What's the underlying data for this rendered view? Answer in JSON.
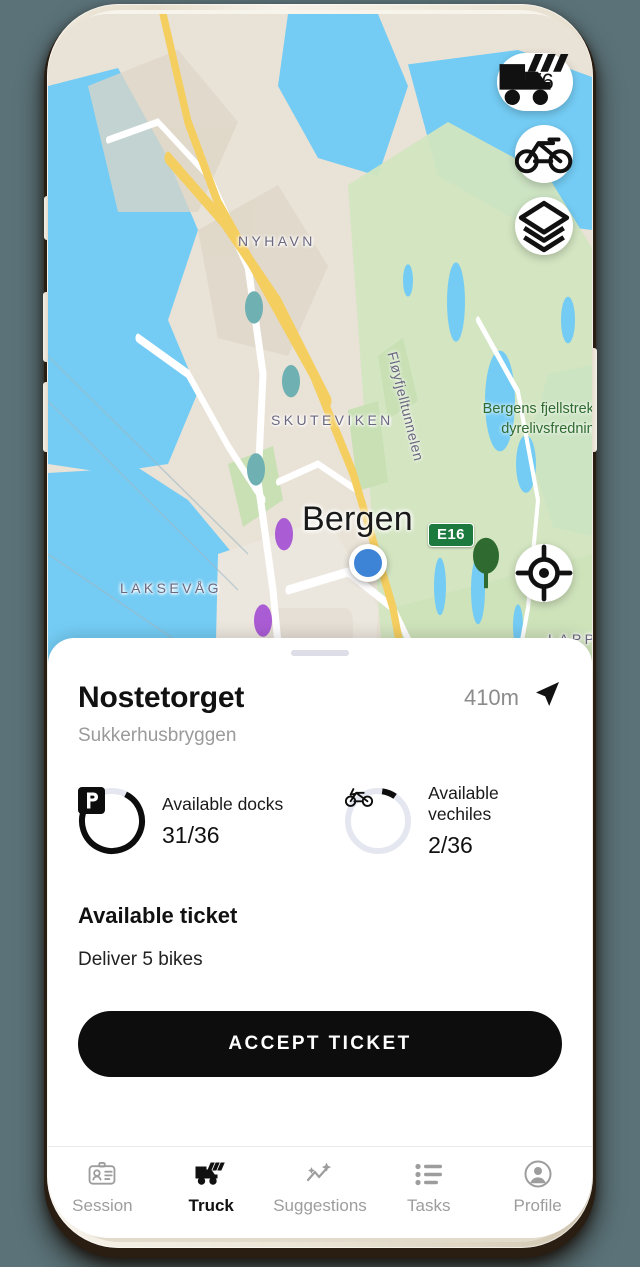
{
  "map": {
    "controls": {
      "truck_capacity": "4/6",
      "truck_icon": "truck-with-bikes-icon",
      "bike_icon": "bike-icon",
      "layers_icon": "layers-icon",
      "locate_icon": "gps-crosshair-icon"
    },
    "labels": {
      "city": "Bergen",
      "nyhavn": "NYHAVN",
      "skuteviken": "SKUTEVIKEN",
      "laksevag": "LAKSEVÅG",
      "lappen": "LAPPEN",
      "tunnel": "Fløyfjelltunnelen",
      "highway_shield": "E16",
      "nature_line1": "Bergens fjellstrekning",
      "nature_line2": "dyrelivsfredning"
    },
    "colors": {
      "station_purple": "#aa5cd4",
      "station_teal": "#6fb0b2",
      "user_dot": "#3d83d6",
      "water": "#74ccf4",
      "forest": "#cfe4bd",
      "land": "#e9e2d6",
      "road": "#f5ce60"
    }
  },
  "sheet": {
    "station_name": "Nostetorget",
    "station_subtitle": "Sukkerhusbryggen",
    "distance": "410m",
    "navigate_icon": "navigation-arrow-icon",
    "stats": [
      {
        "icon": "parking-dock-icon",
        "label": "Available docks",
        "value": "31/36",
        "current": 31,
        "total": 36
      },
      {
        "icon": "bike-icon",
        "label": "Available vechiles",
        "value": "2/36",
        "current": 2,
        "total": 36
      }
    ],
    "ticket_heading": "Available ticket",
    "ticket_description": "Deliver 5 bikes",
    "accept_label": "ACCEPT TICKET"
  },
  "tabbar": {
    "items": [
      {
        "label": "Session",
        "icon": "id-card-icon",
        "active": false
      },
      {
        "label": "Truck",
        "icon": "truck-icon",
        "active": true
      },
      {
        "label": "Suggestions",
        "icon": "sparkle-chart-icon",
        "active": false
      },
      {
        "label": "Tasks",
        "icon": "list-icon",
        "active": false
      },
      {
        "label": "Profile",
        "icon": "person-circle-icon",
        "active": false
      }
    ]
  }
}
